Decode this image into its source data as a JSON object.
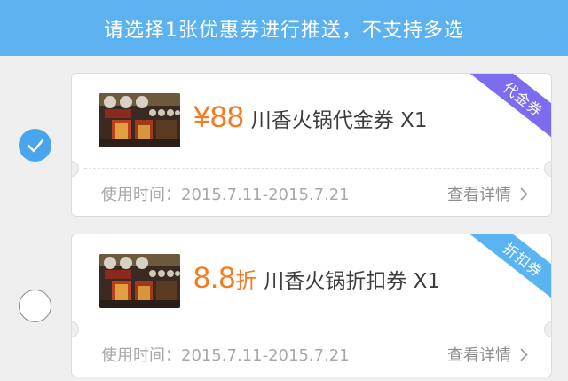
{
  "header": {
    "title": "请选择1张优惠券进行推送，不支持多选"
  },
  "coupons": [
    {
      "selected": true,
      "price_prefix": "¥",
      "price": "88",
      "price_suffix": "",
      "desc": "川香火锅代金券 X1",
      "validity": "使用时间：2015.7.11-2015.7.21",
      "detail": "查看详情",
      "ribbon": "代金券",
      "ribbon_color": "#7b6cf0"
    },
    {
      "selected": false,
      "price_prefix": "",
      "price": "8.8",
      "price_suffix": "折",
      "desc": "川香火锅折扣券 X1",
      "validity": "使用时间：2015.7.11-2015.7.21",
      "detail": "查看详情",
      "ribbon": "折扣券",
      "ribbon_color": "#5ab4f2"
    }
  ],
  "colors": {
    "header_bg": "#5cb2f0",
    "price": "#f47b20",
    "radio_checked": "#4aa6ec"
  }
}
